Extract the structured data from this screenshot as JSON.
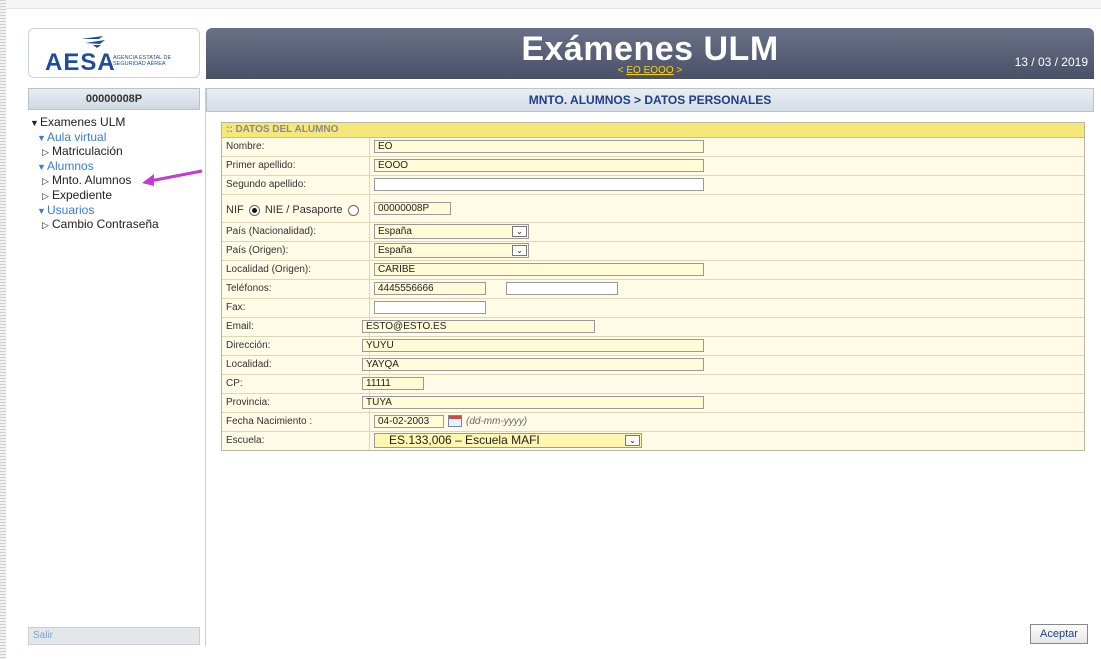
{
  "header": {
    "logo_text": "AESA",
    "logo_subtitle": "AGENCIA ESTATAL DE SEGURIDAD AÉREA",
    "app_title": "Exámenes ULM",
    "user_link_prefix": "< ",
    "user_link": "EO EOOO",
    "user_link_suffix": " >",
    "date": "13 / 03 / 2019"
  },
  "sidebar": {
    "user_id": "00000008P",
    "tree": [
      {
        "label": "Examenes ULM",
        "level": 1,
        "marker": "▼"
      },
      {
        "label": "Aula virtual",
        "level": 2,
        "marker": "▼"
      },
      {
        "label": "Matriculación",
        "level": 3,
        "marker": "▷"
      },
      {
        "label": "Alumnos",
        "level": 2,
        "marker": "▼"
      },
      {
        "label": "Mnto. Alumnos",
        "level": 3,
        "marker": "▷"
      },
      {
        "label": "Expediente",
        "level": 3,
        "marker": "▷"
      },
      {
        "label": "Usuarios",
        "level": 2,
        "marker": "▼"
      },
      {
        "label": "Cambio Contraseña",
        "level": 3,
        "marker": "▷"
      }
    ],
    "salir": "Salir"
  },
  "breadcrumb": "MNTO. ALUMNOS > DATOS PERSONALES",
  "form": {
    "section_title": ":: DATOS DEL ALUMNO",
    "nombre": {
      "label": "Nombre:",
      "value": "EO"
    },
    "primer_apellido": {
      "label": "Primer apellido:",
      "value": "EOOO"
    },
    "segundo_apellido": {
      "label": "Segundo apellido:",
      "value": ""
    },
    "doc": {
      "nif_label": "NIF",
      "nie_label": "NIE / Pasaporte",
      "value": "00000008P",
      "selected": "NIF"
    },
    "pais_nacionalidad": {
      "label": "País (Nacionalidad):",
      "value": "España"
    },
    "pais_origen": {
      "label": "País (Origen):",
      "value": "España"
    },
    "localidad_origen": {
      "label": "Localidad (Origen):",
      "value": "CARIBE"
    },
    "telefonos": {
      "label": "Teléfonos:",
      "value": "4445556666",
      "value2": ""
    },
    "fax": {
      "label": "Fax:",
      "value": ""
    },
    "email": {
      "label": "Email:",
      "value": "ESTO@ESTO.ES"
    },
    "direccion": {
      "label": "Dirección:",
      "value": "YUYU"
    },
    "localidad": {
      "label": "Localidad:",
      "value": "YAYQA"
    },
    "cp": {
      "label": "CP:",
      "value": "11111"
    },
    "provincia": {
      "label": "Provincia:",
      "value": "TUYA"
    },
    "fecha_nacimiento": {
      "label": "Fecha Nacimiento :",
      "value": "04-02-2003",
      "hint": "(dd-mm-yyyy)"
    },
    "escuela": {
      "label": "Escuela:",
      "value": "ES.133,006 – Escuela MAFI"
    }
  },
  "buttons": {
    "aceptar": "Aceptar"
  },
  "colors": {
    "header": "#4a5067",
    "accent_yellow": "#f6e77a",
    "link_blue": "#3a7bd5",
    "arrow": "#c43ad6"
  }
}
